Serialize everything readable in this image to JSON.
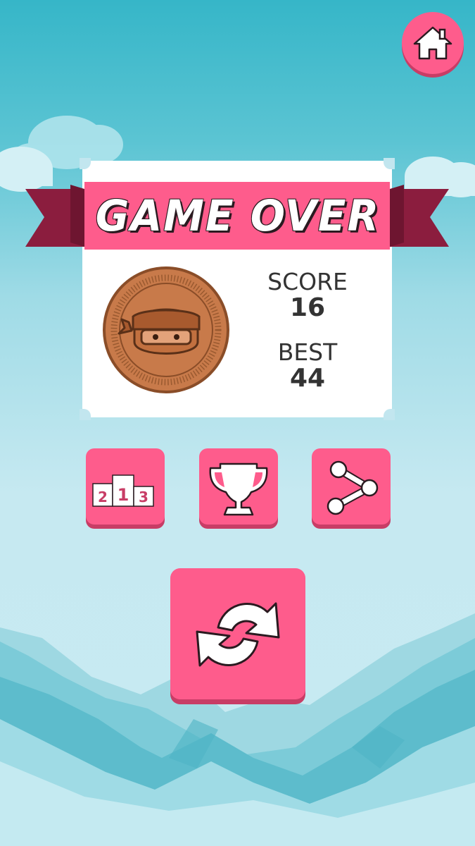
{
  "title": "GAME OVER",
  "score_label": "SCORE",
  "score_value": "16",
  "best_label": "BEST",
  "best_value": "44",
  "medal": "bronze",
  "podium_digits": {
    "left": "2",
    "center": "1",
    "right": "3"
  },
  "colors": {
    "accent_pink": "#fe5c8c",
    "ribbon_dark": "#8b1d3e",
    "coin_bronze": "#c87a4a",
    "sky_top": "#36b6c8",
    "sky_bottom": "#c8eaf2"
  },
  "icons": [
    "home-icon",
    "leaderboard-icon",
    "trophy-icon",
    "share-icon",
    "replay-icon",
    "ninja-coin-icon"
  ]
}
